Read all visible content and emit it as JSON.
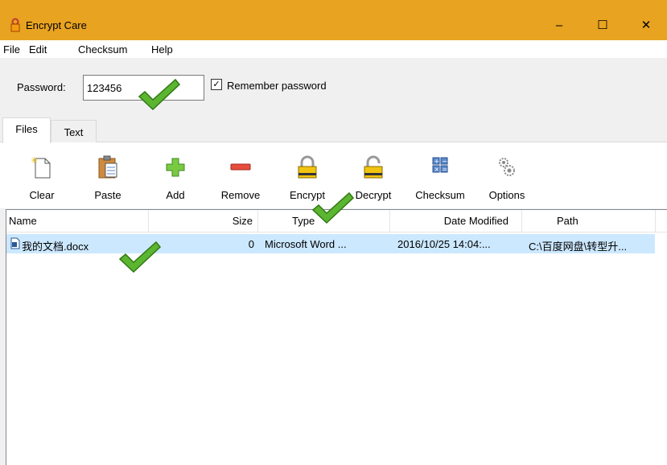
{
  "window": {
    "title": "Encrypt Care",
    "minimize": "–",
    "maximize": "☐",
    "close": "✕"
  },
  "menu": [
    "File",
    "Edit",
    "Checksum",
    "Help"
  ],
  "password": {
    "label": "Password:",
    "value": "123456"
  },
  "remember": {
    "checked": true,
    "mark": "✓",
    "label": "Remember password"
  },
  "tabs": [
    "Files",
    "Text"
  ],
  "toolbar": [
    "Clear",
    "Paste",
    "Add",
    "Remove",
    "Encrypt",
    "Decrypt",
    "Checksum",
    "Options"
  ],
  "list": {
    "columns": [
      "Name",
      "Size",
      "Type",
      "Date Modified",
      "Path"
    ],
    "rows": [
      {
        "name": "我的文档.docx",
        "size": "0",
        "type": "Microsoft Word ...",
        "modified": "2016/10/25 14:04:...",
        "path": "C:\\百度网盘\\转型升..."
      }
    ]
  },
  "colors": {
    "titlebar": "#e8a321",
    "selection": "#cce8ff",
    "checkmark": "#4caf28"
  }
}
